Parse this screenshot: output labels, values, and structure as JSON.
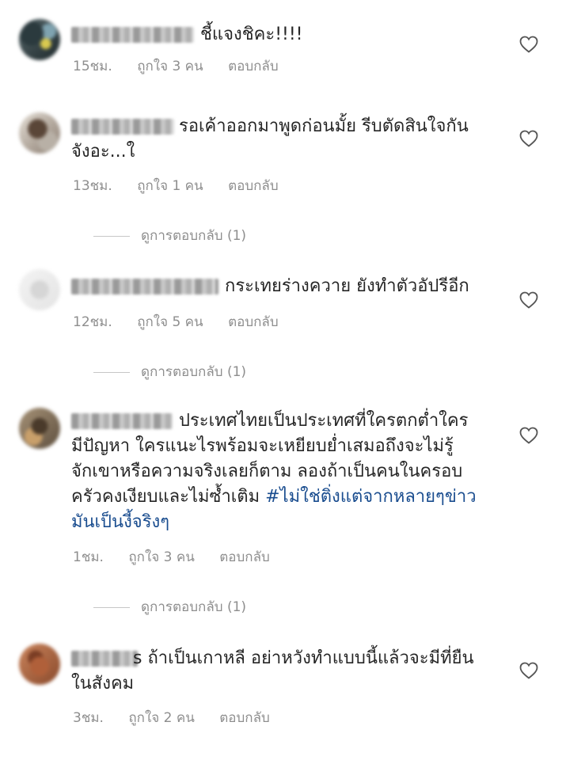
{
  "comments": [
    {
      "text_lines": [
        "ชี้แจงชิคะ!!!!"
      ],
      "time": "15ชม.",
      "likes": "ถูกใจ 3 คน",
      "reply": "ตอบกลับ"
    },
    {
      "text_lines": [
        "รอเค้าออกมาพูดก่อนมั้ย รีบตัดสินใจกัน",
        "จังอะ...ใ"
      ],
      "time": "13ชม.",
      "likes": "ถูกใจ 1 คน",
      "reply": "ตอบกลับ",
      "view_replies": "ดูการตอบกลับ (1)"
    },
    {
      "text_lines": [
        "กระเทยร่างควาย ยังทำตัวอัปรีอีก"
      ],
      "time": "12ชม.",
      "likes": "ถูกใจ 5 คน",
      "reply": "ตอบกลับ",
      "view_replies": "ดูการตอบกลับ (1)"
    },
    {
      "text_lines": [
        "ประเทศไทยเป็นประเทศที่ใครตกต่ำใคร",
        "มีปัญหา ใครแนะไรพร้อมจะเหยียบย่ำเสมอถึงจะไม่รู้",
        "จักเขาหรือความจริงเลยก็ตาม ลองถ้าเป็นคนในครอบ",
        "ครัวคงเงียบและไม่ซ้ำเติม ",
        "มันเป็นงี้จริงๆ"
      ],
      "hashtag_part1": "#ไม่ใช่ติ่งแต่จากหลายๆข่าว",
      "time": "1ชม.",
      "likes": "ถูกใจ 3 คน",
      "reply": "ตอบกลับ",
      "view_replies": "ดูการตอบกลับ (1)"
    },
    {
      "text_lines": [
        "s ถ้าเป็นเกาหลี อย่าหวังทำแบบนี้แล้วจะมีที่ยืน",
        "ในสังคม"
      ],
      "time": "3ชม.",
      "likes": "ถูกใจ 2 คน",
      "reply": "ตอบกลับ"
    }
  ],
  "icons": {
    "like": "heart-outline-icon"
  },
  "colors": {
    "text": "#262626",
    "meta": "#8e8e8e",
    "hashtag": "#1a4d8f"
  }
}
